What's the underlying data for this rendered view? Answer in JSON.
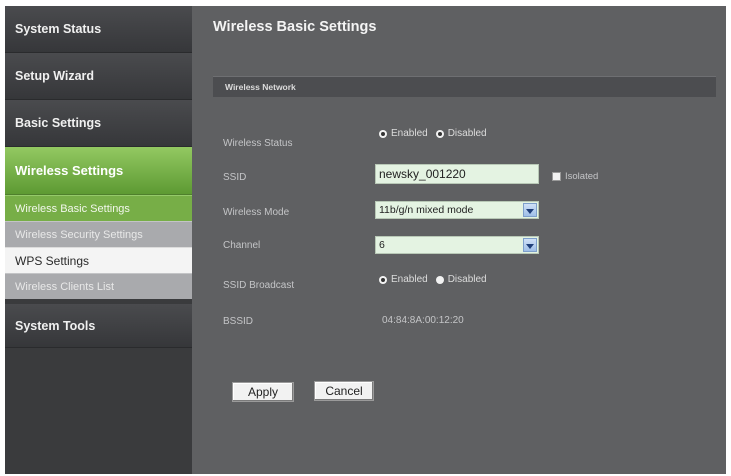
{
  "sidebar": {
    "items": [
      {
        "label": "System Status"
      },
      {
        "label": "Setup Wizard"
      },
      {
        "label": "Basic Settings"
      },
      {
        "label": "Wireless Settings"
      },
      {
        "label": "System Tools"
      }
    ],
    "wireless_subitems": [
      {
        "label": "Wireless Basic Settings"
      },
      {
        "label": "Wireless Security Settings"
      },
      {
        "label": "WPS Settings"
      },
      {
        "label": "Wireless Clients List"
      }
    ]
  },
  "main": {
    "title": "Wireless Basic Settings",
    "section_title": "Wireless Network",
    "wireless_status": {
      "label": "Wireless Status",
      "option_enabled": "Enabled",
      "option_disabled": "Disabled",
      "selected": "Enabled"
    },
    "ssid": {
      "label": "SSID",
      "value": "newsky_001220",
      "isolated_label": "Isolated"
    },
    "wireless_mode": {
      "label": "Wireless Mode",
      "selected": "11b/g/n mixed mode"
    },
    "channel": {
      "label": "Channel",
      "selected": "6"
    },
    "ssid_broadcast": {
      "label": "SSID Broadcast",
      "option_enabled": "Enabled",
      "option_disabled": "Disabled",
      "selected": "Enabled"
    },
    "bssid": {
      "label": "BSSID",
      "value": "04:84:8A:00:12:20"
    },
    "buttons": {
      "apply": "Apply",
      "cancel": "Cancel"
    }
  },
  "colors": {
    "frame_bg": "#5f6062",
    "sidebar_bg": "#3a3b3d",
    "active_green": "#6fab42",
    "input_bg": "#e4f3e2"
  }
}
